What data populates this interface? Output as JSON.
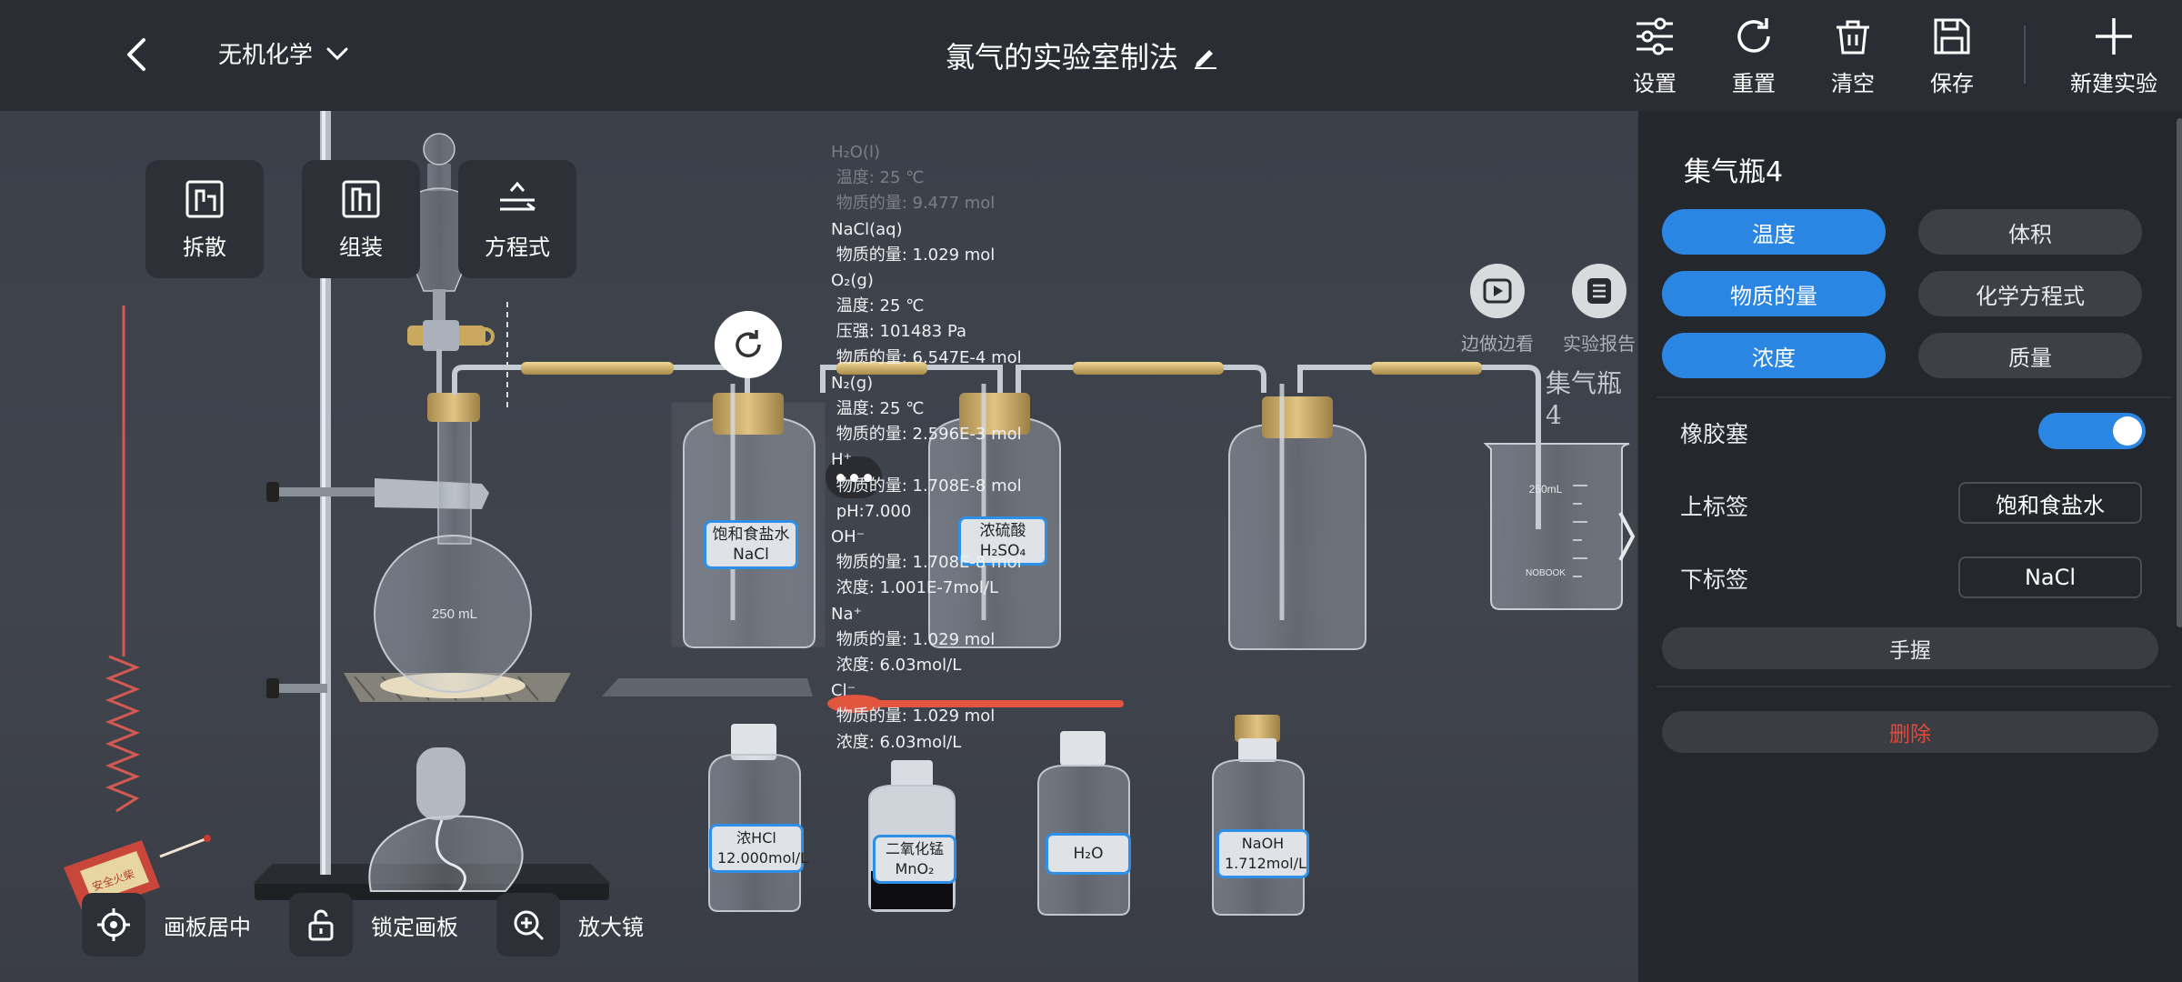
{
  "header": {
    "subject": "无机化学",
    "title": "氯气的实验室制法",
    "buttons": {
      "settings": "设置",
      "reset": "重置",
      "clear": "清空",
      "save": "保存",
      "new": "新建实验"
    }
  },
  "toolbar": {
    "disassemble": "拆散",
    "assemble": "组装",
    "equation": "方程式"
  },
  "bottom_tools": {
    "center": "画板居中",
    "lock": "锁定画板",
    "magnifier": "放大镜"
  },
  "side_buttons": {
    "video": "边做边看",
    "report": "实验报告"
  },
  "selected_label": "集气瓶4",
  "info_lines": [
    "H₂O(l)",
    " 温度: 25 ℃",
    " 物质的量: 9.477 mol",
    "NaCl(aq)",
    " 物质的量: 1.029 mol",
    "O₂(g)",
    " 温度: 25 ℃",
    " 压强: 101483 Pa",
    " 物质的量: 6.547E-4 mol",
    "N₂(g)",
    " 温度: 25 ℃",
    " 物质的量: 2.596E-3 mol",
    "H⁺",
    " 物质的量: 1.708E-8 mol",
    " pH:7.000",
    "OH⁻",
    " 物质的量: 1.708E-8 mol",
    " 浓度: 1.001E-7mol/L",
    "Na⁺",
    " 物质的量: 1.029 mol",
    " 浓度: 6.03mol/L",
    "Cl⁻",
    " 物质的量: 1.029 mol",
    " 浓度: 6.03mol/L"
  ],
  "apparatus": {
    "flask_volume": "250 mL",
    "beaker_volume": "250mL",
    "beaker_brand": "NOBOOK",
    "bottle1": {
      "top": "饱和食盐水",
      "bottom": "NaCl"
    },
    "bottle2": {
      "top": "浓硫酸",
      "bottom": "H₂SO₄"
    },
    "reagent1": {
      "top": "浓HCl",
      "bottom": "12.000mol/L"
    },
    "reagent2": {
      "top": "二氧化锰",
      "bottom": "MnO₂"
    },
    "reagent3": {
      "top": "H₂O",
      "bottom": ""
    },
    "reagent4": {
      "top": "NaOH",
      "bottom": "1.712mol/L"
    },
    "matchbox": "安全火柴"
  },
  "panel": {
    "title": "集气瓶4",
    "chips": [
      {
        "label": "温度",
        "active": true
      },
      {
        "label": "体积",
        "active": false
      },
      {
        "label": "物质的量",
        "active": true
      },
      {
        "label": "化学方程式",
        "active": false
      },
      {
        "label": "浓度",
        "active": true
      },
      {
        "label": "质量",
        "active": false
      }
    ],
    "stopper_label": "橡胶塞",
    "stopper_on": true,
    "top_label": "上标签",
    "top_value": "饱和食盐水",
    "bottom_label": "下标签",
    "bottom_value": "NaCl",
    "hand_hold": "手握",
    "delete": "删除"
  },
  "colors": {
    "accent": "#2a86e2",
    "delete": "#e24a3b",
    "panel_bg": "#24272c",
    "topbar_bg": "#2a2d33"
  }
}
